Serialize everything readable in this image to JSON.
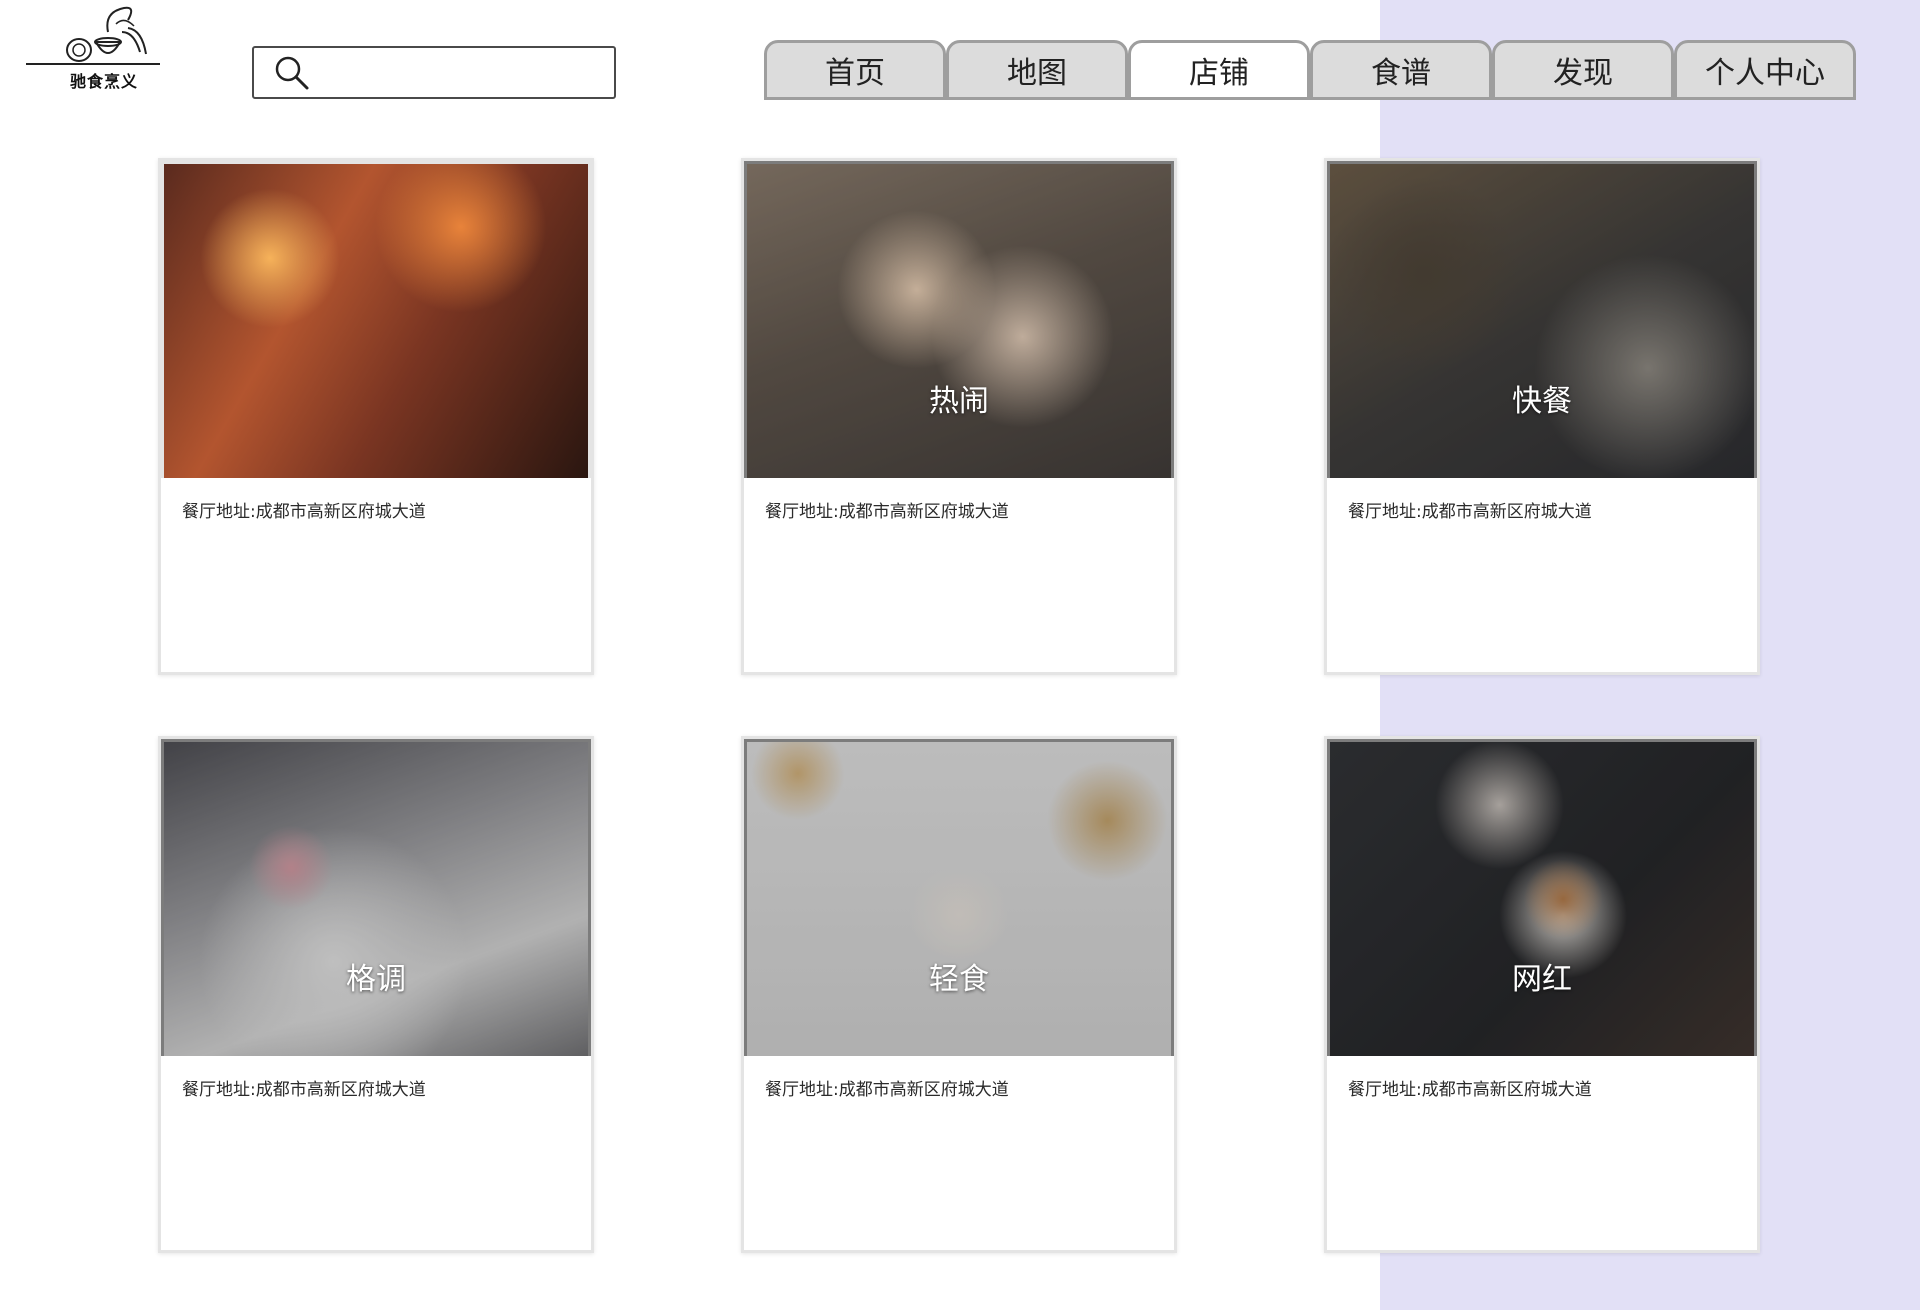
{
  "colors": {
    "side_panel": "#e2e0f6",
    "tab_bg": "#dcdcdc",
    "tab_active_bg": "#ffffff",
    "tab_border": "#9e9e9e"
  },
  "logo": {
    "text": "驰食烹义",
    "icon": "bowl-and-spoon-logo-icon"
  },
  "search": {
    "icon": "search-icon",
    "value": "",
    "placeholder": ""
  },
  "nav": {
    "tabs": [
      {
        "label": "首页",
        "active": false
      },
      {
        "label": "地图",
        "active": false
      },
      {
        "label": "店铺",
        "active": true
      },
      {
        "label": "食谱",
        "active": false
      },
      {
        "label": "发现",
        "active": false
      },
      {
        "label": "个人中心",
        "active": false
      }
    ]
  },
  "cards": [
    {
      "tag": "",
      "address": "餐厅地址:成都市高新区府城大道"
    },
    {
      "tag": "热闹",
      "address": "餐厅地址:成都市高新区府城大道"
    },
    {
      "tag": "快餐",
      "address": "餐厅地址:成都市高新区府城大道"
    },
    {
      "tag": "格调",
      "address": "餐厅地址:成都市高新区府城大道"
    },
    {
      "tag": "轻食",
      "address": "餐厅地址:成都市高新区府城大道"
    },
    {
      "tag": "网红",
      "address": "餐厅地址:成都市高新区府城大道"
    }
  ]
}
